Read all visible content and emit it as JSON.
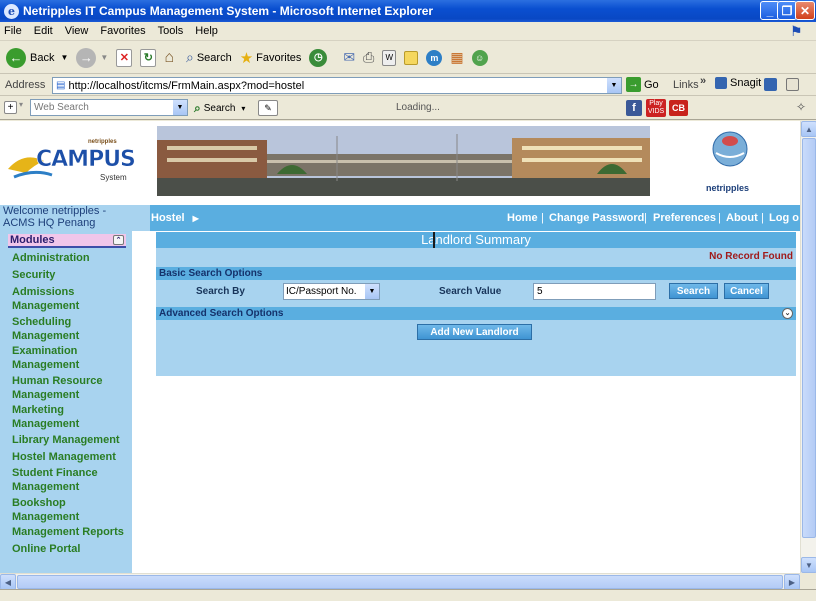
{
  "window": {
    "title": "Netripples IT Campus Management System - Microsoft Internet Explorer"
  },
  "menubar": [
    "File",
    "Edit",
    "View",
    "Favorites",
    "Tools",
    "Help"
  ],
  "toolbar": {
    "back": "Back",
    "search": "Search",
    "favorites": "Favorites"
  },
  "address": {
    "label": "Address",
    "url": "http://localhost/itcms/FrmMain.aspx?mod=hostel",
    "go": "Go",
    "links": "Links",
    "snagit": "Snagit"
  },
  "linksbar": {
    "websearch_placeholder": "Web Search",
    "search": "Search",
    "loading": "Loading...",
    "play": "Play",
    "vids": "VIDS",
    "cb": "CB"
  },
  "banner": {
    "logo_brand": "netripples",
    "logo_title": "CAMPUS",
    "logo_sub": "System",
    "right_brand": "netripples"
  },
  "welcome": "Welcome netripples - ACMS HQ Penang",
  "nav": {
    "section": "Hostel",
    "links": [
      "Home",
      "Change Password",
      "Preferences",
      "About",
      "Log o"
    ]
  },
  "sidebar": {
    "header": "Modules",
    "items": [
      "Administration",
      "Security",
      "Admissions Management",
      "Scheduling Management",
      "Examination Management",
      "Human Resource Management",
      "Marketing Management",
      "Library Management",
      "Hostel Management",
      "Student Finance Management",
      "Bookshop Management",
      "Management Reports",
      "Online Portal"
    ]
  },
  "main": {
    "title": "Landlord Summary",
    "no_record": "No Record Found",
    "basic_search": "Basic Search Options",
    "search_by_label": "Search By",
    "search_by_value": "IC/Passport No.",
    "search_value_label": "Search Value",
    "search_value": "5",
    "search_button": "Search",
    "cancel_button": "Cancel",
    "advanced_search": "Advanced Search Options",
    "add_button": "Add New Landlord"
  }
}
